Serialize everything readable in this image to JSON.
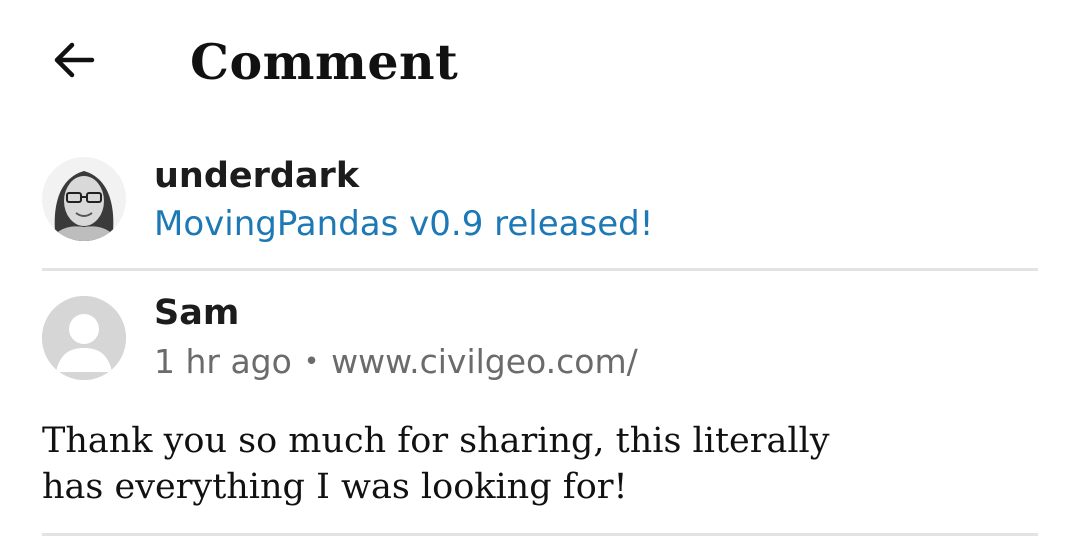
{
  "header": {
    "title": "Comment",
    "back_icon": "arrow-left-icon"
  },
  "post": {
    "author": "underdark",
    "title": "MovingPandas v0.9 released!",
    "link_color": "#1d79b6"
  },
  "comment": {
    "author": "Sam",
    "time": "1 hr ago",
    "separator": "•",
    "website": "www.civilgeo.com/",
    "text": "Thank you so much for sharing, this literally\nhas everything I was looking for!",
    "avatar_icon": "default-user-icon"
  },
  "colors": {
    "divider": "#e3e3e3",
    "meta_text": "#6b6b6b",
    "placeholder_avatar": "#d6d6d6"
  }
}
